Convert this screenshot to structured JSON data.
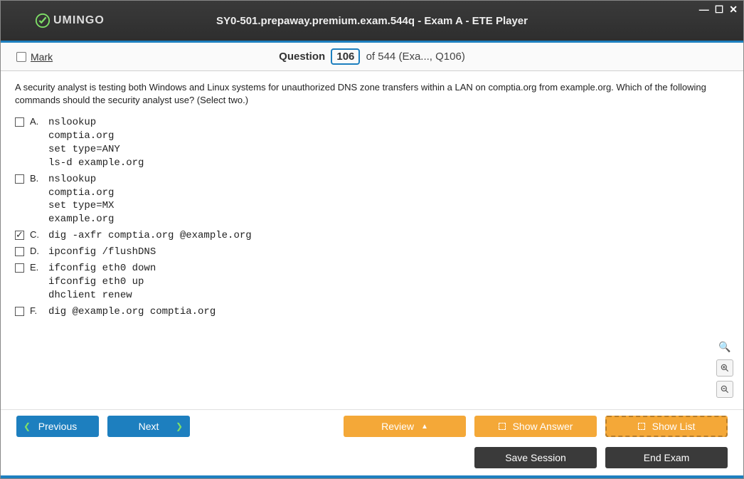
{
  "window": {
    "brand": "UMINGO",
    "title": "SY0-501.prepaway.premium.exam.544q - Exam A - ETE Player"
  },
  "info": {
    "mark_label": "Mark",
    "question_word": "Question",
    "current": "106",
    "of_word": "of",
    "total": "544",
    "context": "(Exa..., Q106)"
  },
  "question": {
    "text": "A security analyst is testing both Windows and Linux systems for unauthorized DNS zone transfers within a LAN on comptia.org from example.org. Which of the following commands should the security analyst use? (Select two.)"
  },
  "answers": [
    {
      "letter": "A.",
      "checked": false,
      "body": "nslookup\ncomptia.org\nset type=ANY\nls-d example.org"
    },
    {
      "letter": "B.",
      "checked": false,
      "body": "nslookup\ncomptia.org\nset type=MX\nexample.org"
    },
    {
      "letter": "C.",
      "checked": true,
      "body": "dig -axfr comptia.org @example.org"
    },
    {
      "letter": "D.",
      "checked": false,
      "body": "ipconfig /flushDNS"
    },
    {
      "letter": "E.",
      "checked": false,
      "body": "ifconfig eth0 down\nifconfig eth0 up\ndhclient renew"
    },
    {
      "letter": "F.",
      "checked": false,
      "body": "dig @example.org comptia.org"
    }
  ],
  "buttons": {
    "previous": "Previous",
    "next": "Next",
    "review": "Review",
    "show_answer": "Show Answer",
    "show_list": "Show List",
    "save_session": "Save Session",
    "end_exam": "End Exam"
  }
}
